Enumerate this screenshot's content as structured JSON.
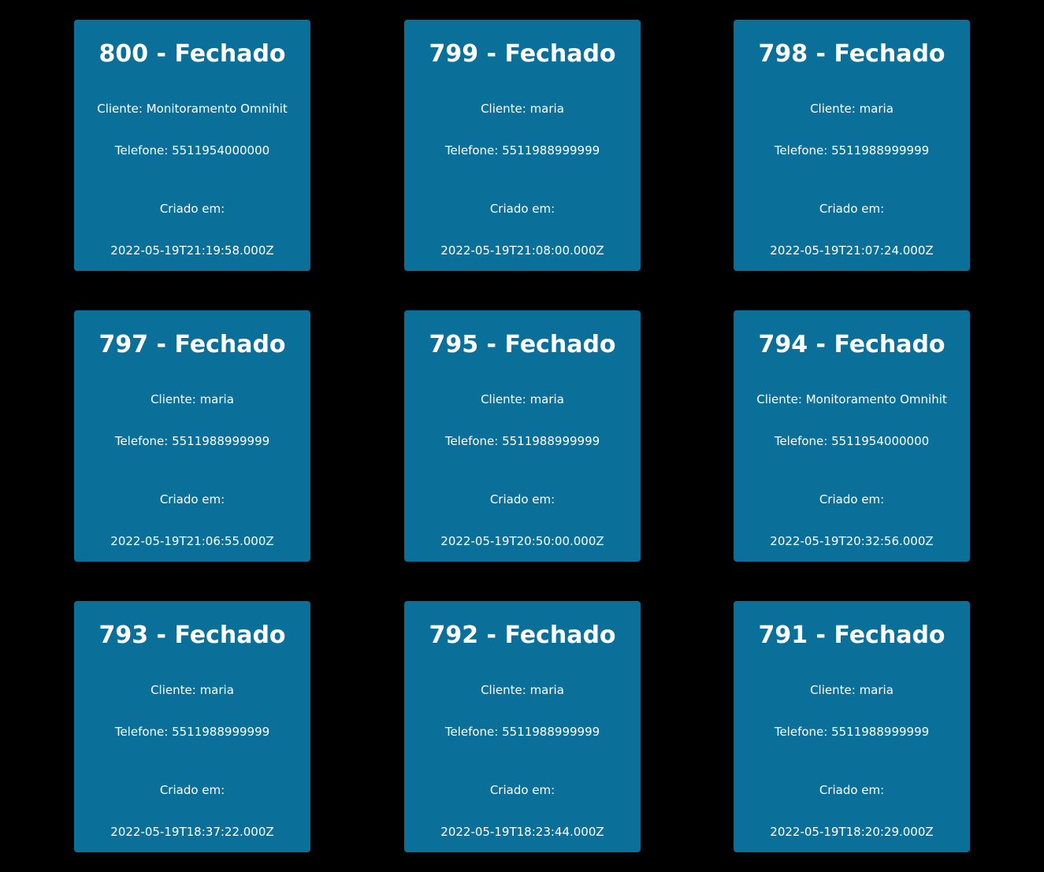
{
  "labels": {
    "cliente_prefix": "Cliente: ",
    "telefone_prefix": "Telefone: ",
    "criado_label": "Criado em:",
    "separator": " - "
  },
  "tickets": [
    {
      "id": "800",
      "status": "Fechado",
      "cliente": "Monitoramento Omnihit",
      "telefone": "5511954000000",
      "criado": "2022-05-19T21:19:58.000Z"
    },
    {
      "id": "799",
      "status": "Fechado",
      "cliente": "maria",
      "telefone": "5511988999999",
      "criado": "2022-05-19T21:08:00.000Z"
    },
    {
      "id": "798",
      "status": "Fechado",
      "cliente": "maria",
      "telefone": "5511988999999",
      "criado": "2022-05-19T21:07:24.000Z"
    },
    {
      "id": "797",
      "status": "Fechado",
      "cliente": "maria",
      "telefone": "5511988999999",
      "criado": "2022-05-19T21:06:55.000Z"
    },
    {
      "id": "795",
      "status": "Fechado",
      "cliente": "maria",
      "telefone": "5511988999999",
      "criado": "2022-05-19T20:50:00.000Z"
    },
    {
      "id": "794",
      "status": "Fechado",
      "cliente": "Monitoramento Omnihit",
      "telefone": "5511954000000",
      "criado": "2022-05-19T20:32:56.000Z"
    },
    {
      "id": "793",
      "status": "Fechado",
      "cliente": "maria",
      "telefone": "5511988999999",
      "criado": "2022-05-19T18:37:22.000Z"
    },
    {
      "id": "792",
      "status": "Fechado",
      "cliente": "maria",
      "telefone": "5511988999999",
      "criado": "2022-05-19T18:23:44.000Z"
    },
    {
      "id": "791",
      "status": "Fechado",
      "cliente": "maria",
      "telefone": "5511988999999",
      "criado": "2022-05-19T18:20:29.000Z"
    }
  ]
}
